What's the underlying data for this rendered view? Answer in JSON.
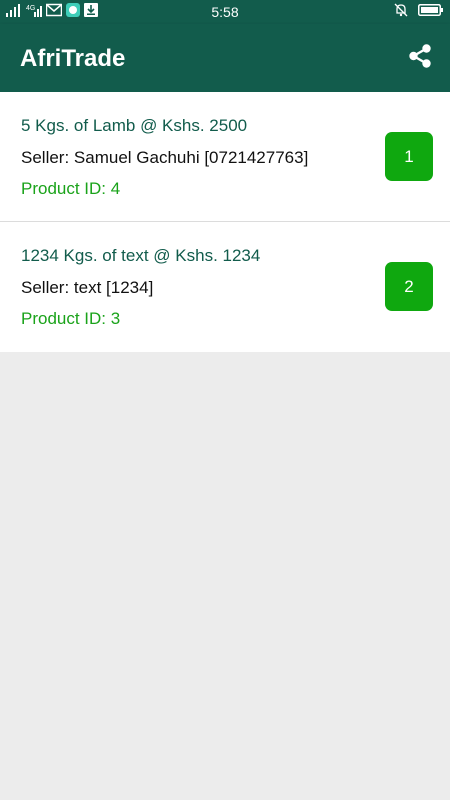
{
  "status_bar": {
    "time": "5:58",
    "signal_label": "4G",
    "icons": [
      "signal-icon",
      "mobile-data-icon",
      "mail-icon",
      "chat-icon",
      "download-icon",
      "bell-off-icon",
      "battery-icon"
    ]
  },
  "app_bar": {
    "title": "AfriTrade",
    "share_icon": "share-icon"
  },
  "colors": {
    "primary": "#125c4c",
    "price_green": "#1aa31a",
    "badge_green": "#0fa80f",
    "background": "#ececec"
  },
  "products": [
    {
      "title": "5 Kgs. of Lamb @ Kshs. 2500",
      "seller": "Seller: Samuel Gachuhi [0721427763]",
      "product_id": "Product ID: 4",
      "badge": "1"
    },
    {
      "title": "1234 Kgs. of text @ Kshs. 1234",
      "seller": "Seller: text [1234]",
      "product_id": "Product ID: 3",
      "badge": "2"
    }
  ]
}
